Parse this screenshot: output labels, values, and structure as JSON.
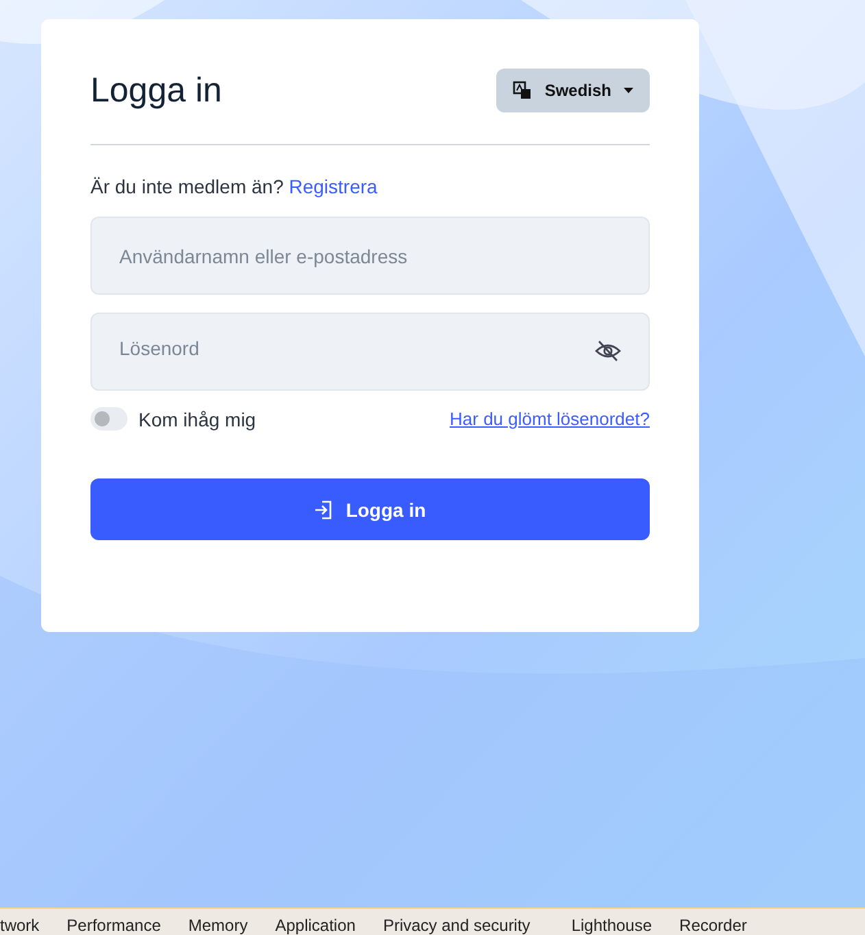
{
  "login": {
    "title": "Logga in",
    "language": "Swedish",
    "register_prompt": "Är du inte medlem än?",
    "register_link": "Registrera",
    "username": {
      "placeholder": "Användarnamn eller e-postadress"
    },
    "password": {
      "placeholder": "Lösenord"
    },
    "remember": {
      "label": "Kom ihåg mig",
      "on": false
    },
    "forgot_link": "Har du glömt lösenordet?",
    "submit": "Logga in"
  },
  "devtools_tabs": [
    {
      "label": "twork"
    },
    {
      "label": "Performance"
    },
    {
      "label": "Memory"
    },
    {
      "label": "Application"
    },
    {
      "label": "Privacy and security"
    },
    {
      "label": "Lighthouse"
    },
    {
      "label": "Recorder"
    }
  ]
}
